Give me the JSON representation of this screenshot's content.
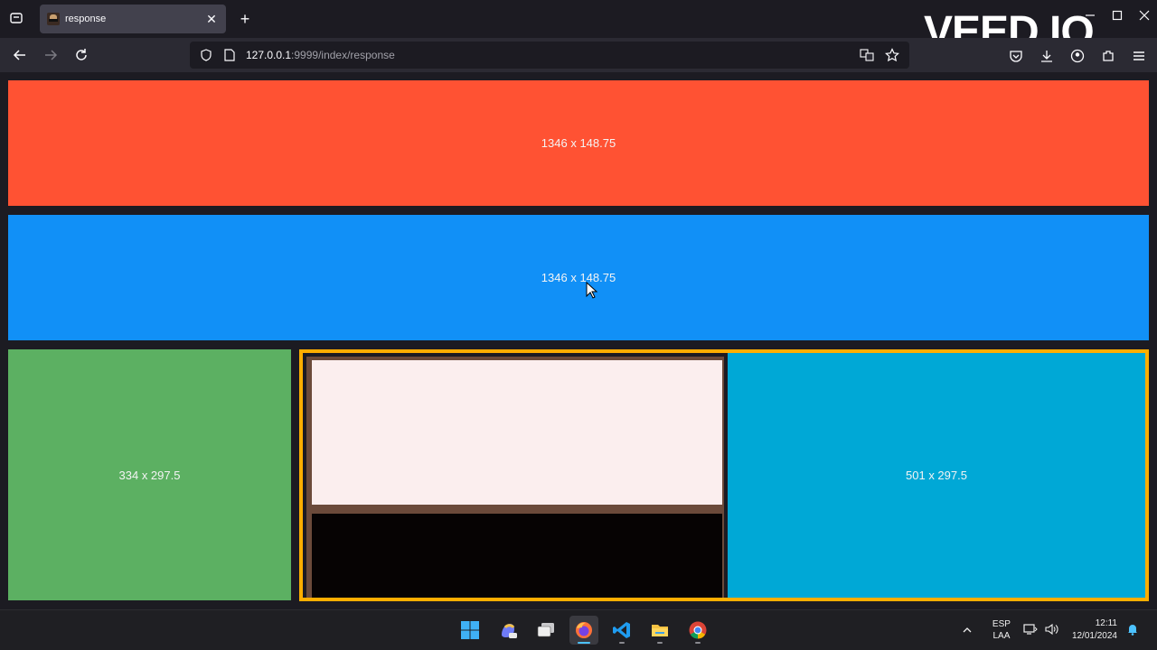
{
  "browser": {
    "tab_title": "response",
    "tab_close_glyph": "✕",
    "new_tab_glyph": "+",
    "url_host": "127.0.0.1",
    "url_path": ":9999/index/response",
    "watermark": "VEED.IO"
  },
  "page": {
    "red_box_label": "1346 x 148.75",
    "blue_box_label": "1346 x 148.75",
    "green_box_label": "334 x 297.5",
    "cyan_box_label": "501 x 297.5",
    "colors": {
      "red": "#ff5233",
      "blue": "#1190f7",
      "green": "#5cb062",
      "orange_border": "#ffae00",
      "brown": "#6b4a3a",
      "pink": "#fbeeee",
      "black": "#060303",
      "cyan": "#00a8d6"
    }
  },
  "taskbar": {
    "apps": [
      "windows-start-icon",
      "copilot-icon",
      "task-view-icon",
      "firefox-icon",
      "vscode-icon",
      "file-explorer-icon",
      "chrome-icon"
    ],
    "lang_line1": "ESP",
    "lang_line2": "LAA",
    "time": "12:11",
    "date": "12/01/2024"
  }
}
